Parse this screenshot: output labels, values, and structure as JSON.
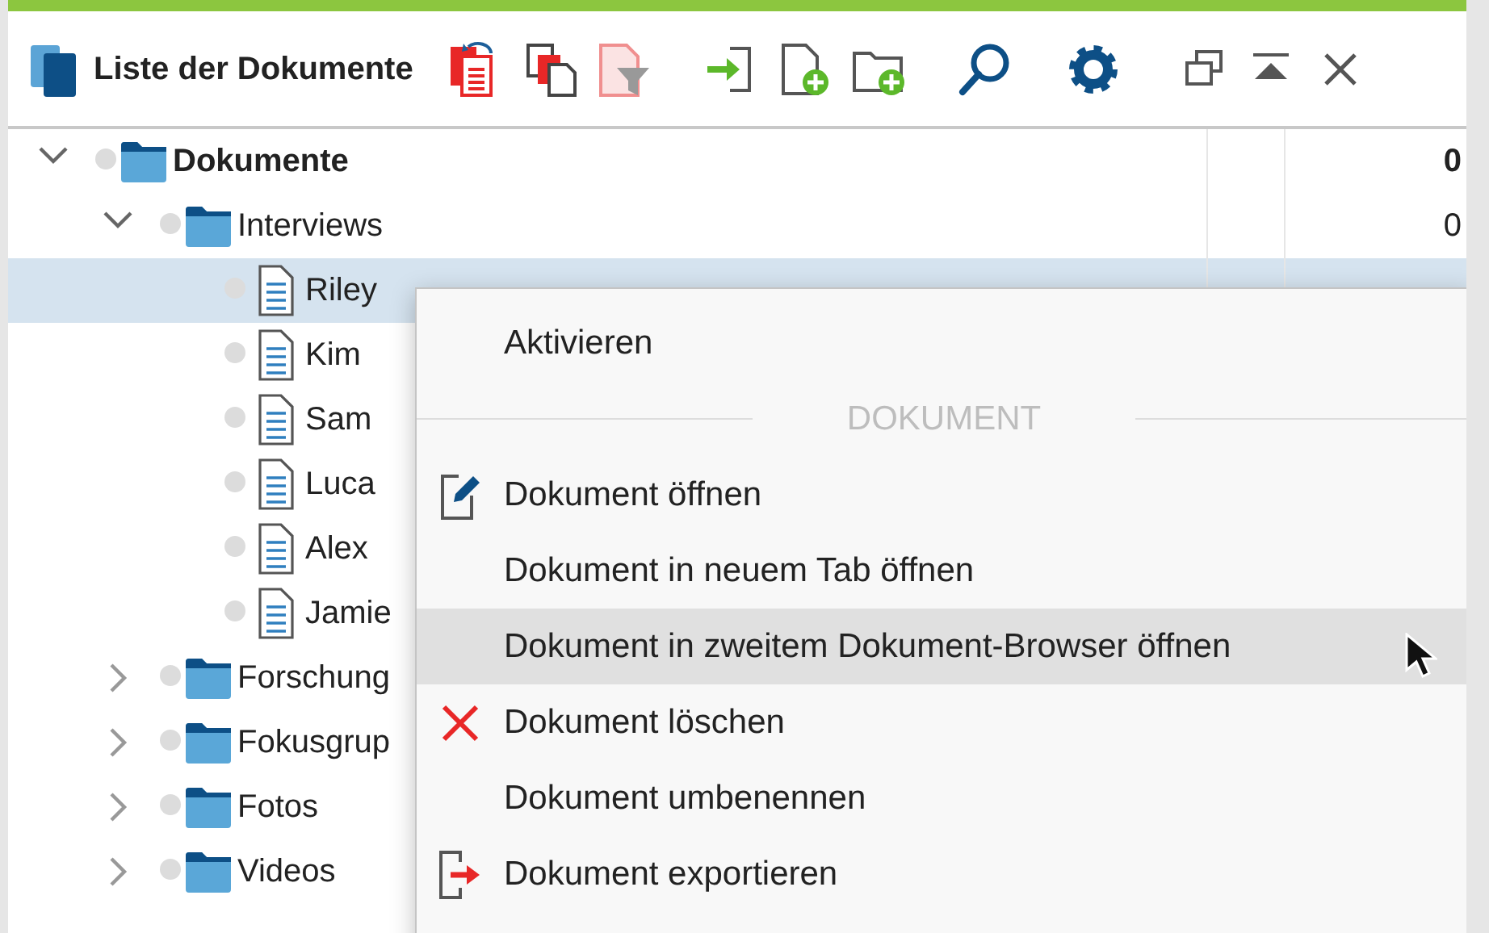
{
  "window": {
    "title": "Liste der Dokumente"
  },
  "tree": [
    {
      "label": "Dokumente",
      "kind": "folder",
      "expanded": true,
      "selected": false,
      "count": "0",
      "children": [
        {
          "label": "Interviews",
          "kind": "folder",
          "expanded": true,
          "selected": false,
          "count": "0",
          "children": [
            {
              "label": "Riley",
              "kind": "document",
              "selected": true
            },
            {
              "label": "Kim",
              "kind": "document",
              "selected": false
            },
            {
              "label": "Sam",
              "kind": "document",
              "selected": false
            },
            {
              "label": "Luca",
              "kind": "document",
              "selected": false
            },
            {
              "label": "Alex",
              "kind": "document",
              "selected": false
            },
            {
              "label": "Jamie",
              "kind": "document",
              "selected": false
            }
          ]
        },
        {
          "label": "Forschung",
          "kind": "folder",
          "expanded": false,
          "selected": false
        },
        {
          "label": "Fokusgrup",
          "kind": "folder",
          "expanded": false,
          "selected": false
        },
        {
          "label": "Fotos",
          "kind": "folder",
          "expanded": false,
          "selected": false
        },
        {
          "label": "Videos",
          "kind": "folder",
          "expanded": false,
          "selected": false
        }
      ]
    }
  ],
  "context_menu": {
    "items": [
      {
        "label": "Aktivieren",
        "kind": "plain",
        "selected": false
      },
      {
        "label": "DOKUMENT",
        "kind": "header"
      },
      {
        "label": "Dokument öffnen",
        "kind": "edit",
        "selected": false
      },
      {
        "label": "Dokument in neuem Tab öffnen",
        "kind": "plain",
        "selected": false
      },
      {
        "label": "Dokument in zweitem Dokument-Browser öffnen",
        "kind": "plain",
        "selected": true
      },
      {
        "label": "Dokument löschen",
        "kind": "delete",
        "selected": false
      },
      {
        "label": "Dokument umbenennen",
        "kind": "plain",
        "selected": false
      },
      {
        "label": "Dokument exportieren",
        "kind": "export",
        "selected": false
      }
    ]
  }
}
